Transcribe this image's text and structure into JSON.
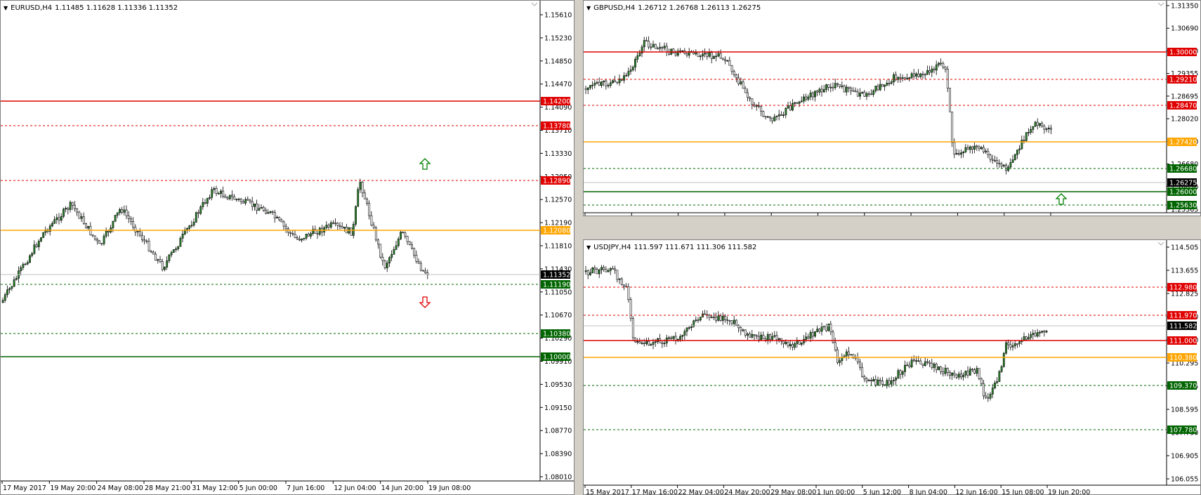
{
  "charts": [
    {
      "id": "eur",
      "title": {
        "symbol": "EURUSD,H4",
        "ohlc": "1.11485 1.11628 1.11336 1.11352"
      },
      "price_labels": [
        "1.15610",
        "1.15230",
        "1.14850",
        "1.14470",
        "1.14090",
        "1.13710",
        "1.13330",
        "1.12950",
        "1.12570",
        "1.12190",
        "1.11810",
        "1.11430",
        "1.11050",
        "1.10670",
        "1.10290",
        "1.09910",
        "1.09530",
        "1.09150",
        "1.08770",
        "1.08390",
        "1.08010"
      ],
      "time_labels": [
        "17 May 2017",
        "19 May 20:00",
        "24 May 08:00",
        "28 May 21:00",
        "31 May 12:00",
        "5 Jun 00:00",
        "7 Jun 16:00",
        "12 Jun 04:00",
        "14 Jun 20:00",
        "19 Jun 08:00"
      ],
      "levels": [
        {
          "label": "1.14200",
          "color": "#e00000",
          "style": "solid"
        },
        {
          "label": "1.13780",
          "color": "#e00000",
          "style": "dashed"
        },
        {
          "label": "1.12890",
          "color": "#e00000",
          "style": "dashed"
        },
        {
          "label": "1.12080",
          "color": "#ffa500",
          "style": "solid"
        },
        {
          "label": "1.11352",
          "color": "#000000",
          "style": "current"
        },
        {
          "label": "1.11190",
          "color": "#006400",
          "style": "dashed"
        },
        {
          "label": "1.10380",
          "color": "#006400",
          "style": "dashed"
        },
        {
          "label": "1.10000",
          "color": "#006400",
          "style": "solid"
        }
      ],
      "arrows": [
        {
          "dir": "up",
          "color": "#008000"
        },
        {
          "dir": "down",
          "color": "#e00000"
        }
      ]
    },
    {
      "id": "gbp",
      "title": {
        "symbol": "GBPUSD,H4",
        "ohlc": "1.26712 1.26768 1.26113 1.26275"
      },
      "price_labels": [
        "1.31350",
        "1.30690",
        "1.30000",
        "1.29355",
        "1.28695",
        "1.28020",
        "1.27360",
        "1.26680",
        "1.26030",
        "1.25365"
      ],
      "time_labels": [
        "15 May 2017",
        "17 May 16:00",
        "22 May 04:00",
        "24 May 20:00",
        "29 May 08:00",
        "1 Jun 00:00",
        "5 Jun 12:00",
        "8 Jun 04:00",
        "12 Jun 16:00",
        "15 Jun 08:00",
        "19 Jun 20:00"
      ],
      "levels": [
        {
          "label": "1.30000",
          "color": "#e00000",
          "style": "solid"
        },
        {
          "label": "1.29210",
          "color": "#e00000",
          "style": "dashed"
        },
        {
          "label": "1.28470",
          "color": "#e00000",
          "style": "dashed"
        },
        {
          "label": "1.27420",
          "color": "#ffa500",
          "style": "solid"
        },
        {
          "label": "1.26680",
          "color": "#006400",
          "style": "dashed"
        },
        {
          "label": "1.26275",
          "color": "#000000",
          "style": "current"
        },
        {
          "label": "1.26000",
          "color": "#006400",
          "style": "solid"
        },
        {
          "label": "1.25630",
          "color": "#006400",
          "style": "dashed"
        }
      ],
      "arrows": [
        {
          "dir": "up",
          "color": "#008000"
        }
      ]
    },
    {
      "id": "jpy",
      "title": {
        "symbol": "USDJPY,H4",
        "ohlc": "111.597 111.671 111.306 111.582"
      },
      "price_labels": [
        "114.505",
        "113.655",
        "112.825",
        "111.970",
        "111.140",
        "110.295",
        "109.445",
        "108.595",
        "107.750",
        "106.905",
        "106.055"
      ],
      "time_labels": [
        "15 May 2017",
        "17 May 16:00",
        "22 May 04:00",
        "24 May 20:00",
        "29 May 08:00",
        "1 Jun 00:00",
        "5 Jun 12:00",
        "8 Jun 04:00",
        "12 Jun 16:00",
        "15 Jun 08:00",
        "19 Jun 20:00"
      ],
      "levels": [
        {
          "label": "112.980",
          "color": "#e00000",
          "style": "dashed"
        },
        {
          "label": "111.970",
          "color": "#e00000",
          "style": "dashed"
        },
        {
          "label": "111.582",
          "color": "#000000",
          "style": "current"
        },
        {
          "label": "111.000",
          "color": "#e00000",
          "style": "solid"
        },
        {
          "label": "110.380",
          "color": "#ffa500",
          "style": "solid"
        },
        {
          "label": "109.370",
          "color": "#006400",
          "style": "dashed"
        },
        {
          "label": "107.780",
          "color": "#006400",
          "style": "dashed"
        }
      ],
      "arrows": []
    }
  ]
}
